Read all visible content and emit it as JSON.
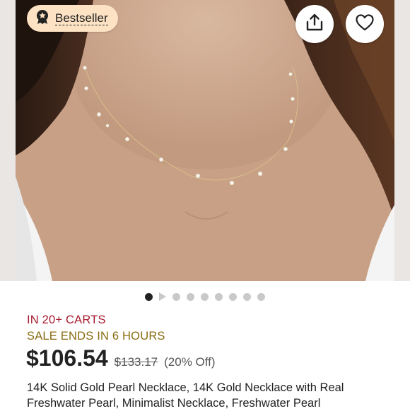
{
  "badge": {
    "label": "Bestseller",
    "icon": "award-ribbon-icon"
  },
  "actions": {
    "share_icon": "share-icon",
    "favorite_icon": "heart-icon"
  },
  "carousel": {
    "total_dots": 8,
    "active_index": 0,
    "video_index": 1
  },
  "status": {
    "carts": "IN 20+ CARTS",
    "sale": "SALE ENDS IN 6 HOURS"
  },
  "pricing": {
    "price": "$106.54",
    "original_price": "$133.17",
    "discount": "(20% Off)"
  },
  "listing": {
    "title": "14K Solid Gold Pearl Necklace, 14K Gold Necklace with Real Freshwater Pearl, Minimalist Necklace, Freshwater Pearl"
  },
  "colors": {
    "carts": "#a61a2e",
    "sale": "#8a6b12",
    "badge_bg": "#fde3c4"
  }
}
